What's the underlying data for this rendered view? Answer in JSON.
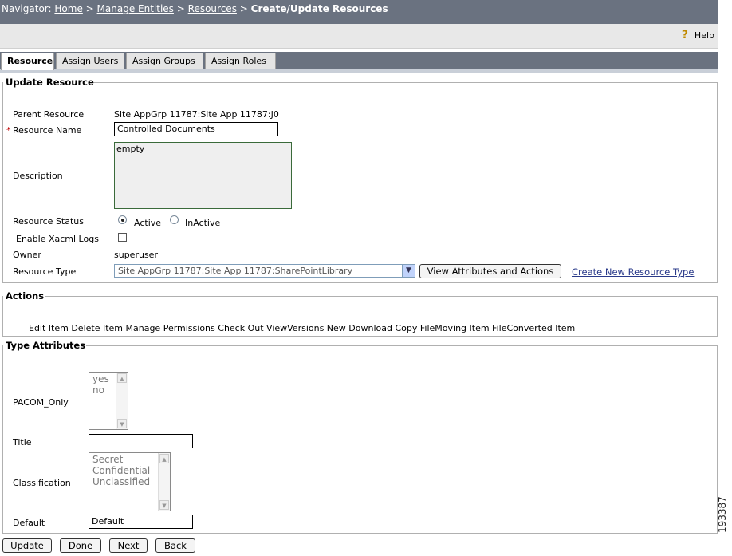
{
  "navigator": {
    "prefix": "Navigator:",
    "crumbs": [
      "Home",
      "Manage Entities",
      "Resources"
    ],
    "separator": ">",
    "current": "Create/Update Resources"
  },
  "help": {
    "label": "Help",
    "icon": "question-mark-icon"
  },
  "tabs": [
    {
      "label": "Resource",
      "active": true
    },
    {
      "label": "Assign Users",
      "active": false
    },
    {
      "label": "Assign Groups",
      "active": false
    },
    {
      "label": "Assign Roles",
      "active": false
    }
  ],
  "update_resource": {
    "legend": "Update Resource",
    "parent_resource": {
      "label": "Parent Resource",
      "value": "Site AppGrp 11787:Site App 11787:J0"
    },
    "resource_name": {
      "required_mark": "*",
      "label": "Resource Name",
      "value": "Controlled Documents"
    },
    "description": {
      "label": "Description",
      "value": "empty"
    },
    "resource_status": {
      "label": "Resource Status",
      "options": [
        "Active",
        "InActive"
      ],
      "selected": "Active"
    },
    "enable_xacml_logs": {
      "label": "Enable Xacml Logs",
      "checked": false
    },
    "owner": {
      "label": "Owner",
      "value": "superuser"
    },
    "resource_type": {
      "label": "Resource Type",
      "selected": "Site AppGrp 11787:Site App 11787:SharePointLibrary",
      "view_button": "View Attributes and Actions",
      "create_link": "Create New Resource Type"
    }
  },
  "actions": {
    "legend": "Actions",
    "list": "Edit Item Delete Item Manage Permissions Check Out ViewVersions New Download Copy FileMoving Item FileConverted Item"
  },
  "type_attributes": {
    "legend": "Type Attributes",
    "pacom_only": {
      "label": "PACOM_Only",
      "options": [
        "yes",
        "no"
      ]
    },
    "title": {
      "label": "Title",
      "value": ""
    },
    "classification": {
      "label": "Classification",
      "options": [
        "Secret",
        "Confidential",
        "Unclassified"
      ]
    },
    "default": {
      "label": "Default",
      "value": "Default"
    }
  },
  "buttons": {
    "update": "Update",
    "done": "Done",
    "next": "Next",
    "back": "Back"
  },
  "figure_id": "193387"
}
